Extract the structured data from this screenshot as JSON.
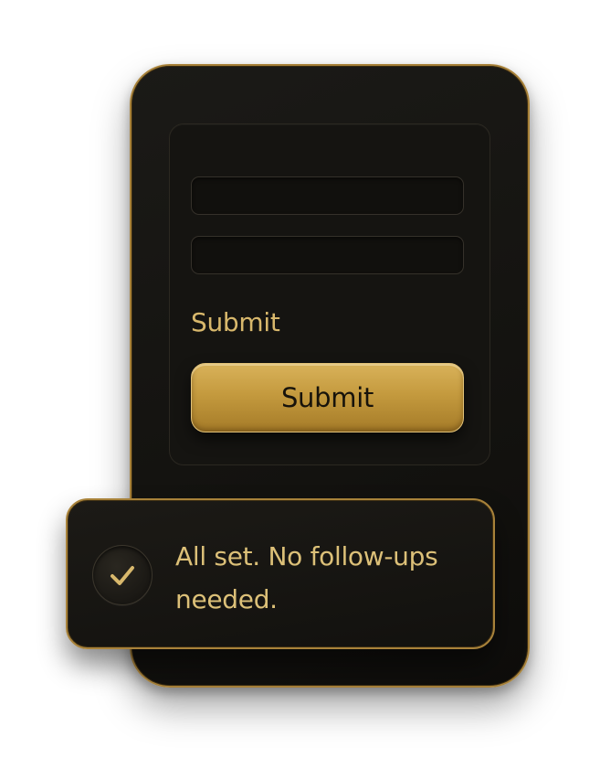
{
  "form": {
    "fields": [
      {
        "value": "",
        "placeholder": ""
      },
      {
        "value": "",
        "placeholder": ""
      }
    ],
    "label": "Submit",
    "submit_button_label": "Submit"
  },
  "toast": {
    "icon": "check-icon",
    "message": "All set. No follow-ups needed."
  },
  "colors": {
    "accent_gold": "#c9a14a",
    "background_dark": "#141310",
    "text_gold": "#d8b86c"
  }
}
